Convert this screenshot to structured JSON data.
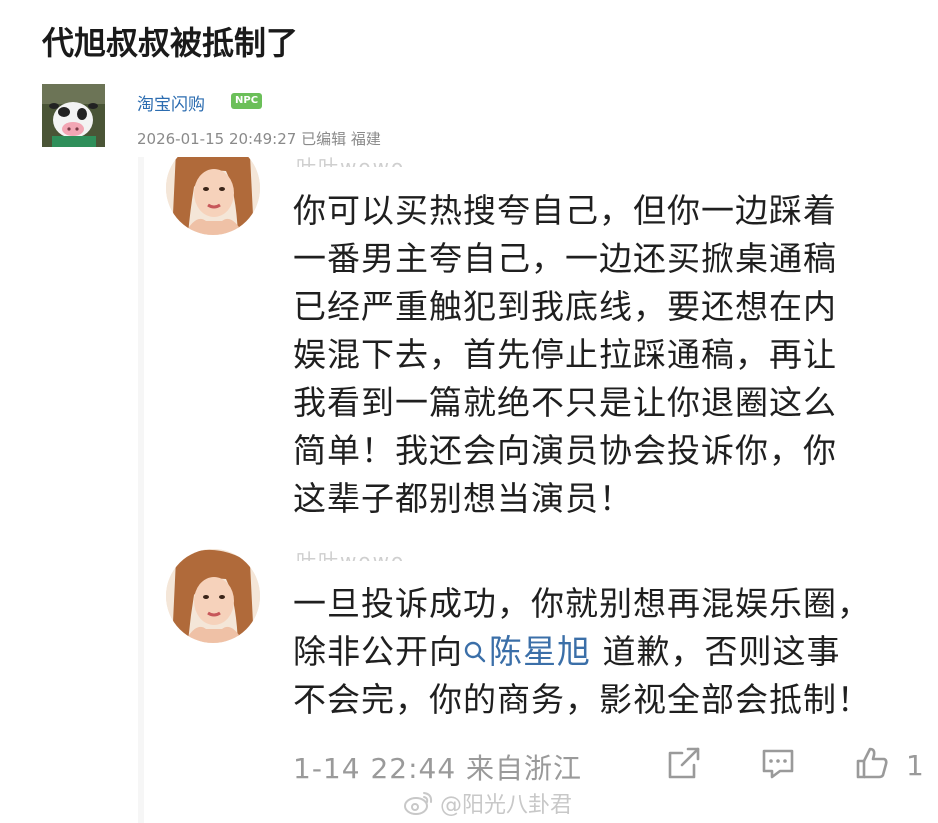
{
  "post": {
    "title": "代旭叔叔被抵制了",
    "author": {
      "name": "淘宝闪购",
      "badge": "NPC",
      "badge_color": "#6bbf59",
      "avatar_icon": "cow-mascot-avatar"
    },
    "meta": "2026-01-15 20:49:27 已编辑 福建"
  },
  "screenshot": {
    "comments": [
      {
        "avatar_icon": "woman-portrait-avatar",
        "lines": [
          "你可以买热搜夸自己，但你一边踩着",
          "一番男主夸自己，一边还买掀桌通稿",
          "已经严重触犯到我底线，要还想在内",
          "娱混下去，首先停止拉踩通稿，再让",
          "我看到一篇就绝不只是让你退圈这么",
          "简单！我还会向演员协会投诉你，你",
          "这辈子都别想当演员！"
        ]
      },
      {
        "avatar_icon": "woman-portrait-avatar",
        "line1": "一旦投诉成功，你就别想再混娱乐圈，",
        "line2_before": "除非公开向",
        "mention_icon": "search-icon",
        "mention": "陈星旭",
        "line2_after": " 道歉，否则这事",
        "line3": "不会完，你的商务，影视全部会抵制！"
      }
    ],
    "ghost_text": "叶叶wowo",
    "footer": {
      "time_location": "1-14 22:44 来自浙江",
      "actions": [
        "share-icon",
        "comment-icon",
        "like-icon"
      ],
      "like_count": "1"
    }
  },
  "watermark": {
    "icon": "weibo-logo-icon",
    "text": "@阳光八卦君"
  }
}
